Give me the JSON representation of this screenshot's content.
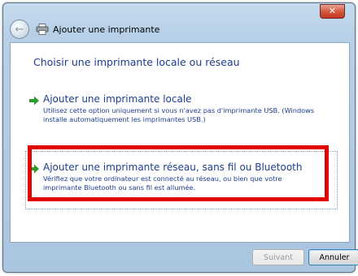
{
  "window": {
    "title": "Ajouter une imprimante",
    "close_label": "✕"
  },
  "content": {
    "heading": "Choisir une imprimante locale ou réseau",
    "options": [
      {
        "title": "Ajouter une imprimante locale",
        "description": "Utilisez cette option uniquement si vous n'avez pas d'imprimante USB. (Windows installe automatiquement les imprimantes USB.)"
      },
      {
        "title": "Ajouter une imprimante réseau, sans fil ou Bluetooth",
        "description": "Vérifiez que votre ordinateur est connecté au réseau, ou bien que votre imprimante Bluetooth ou sans fil est allumée."
      }
    ]
  },
  "footer": {
    "next_label": "Suivant",
    "cancel_label": "Annuler"
  },
  "colors": {
    "accent": "#1e3f8f",
    "highlight": "#e00000",
    "arrow": "#2e9a2e"
  }
}
